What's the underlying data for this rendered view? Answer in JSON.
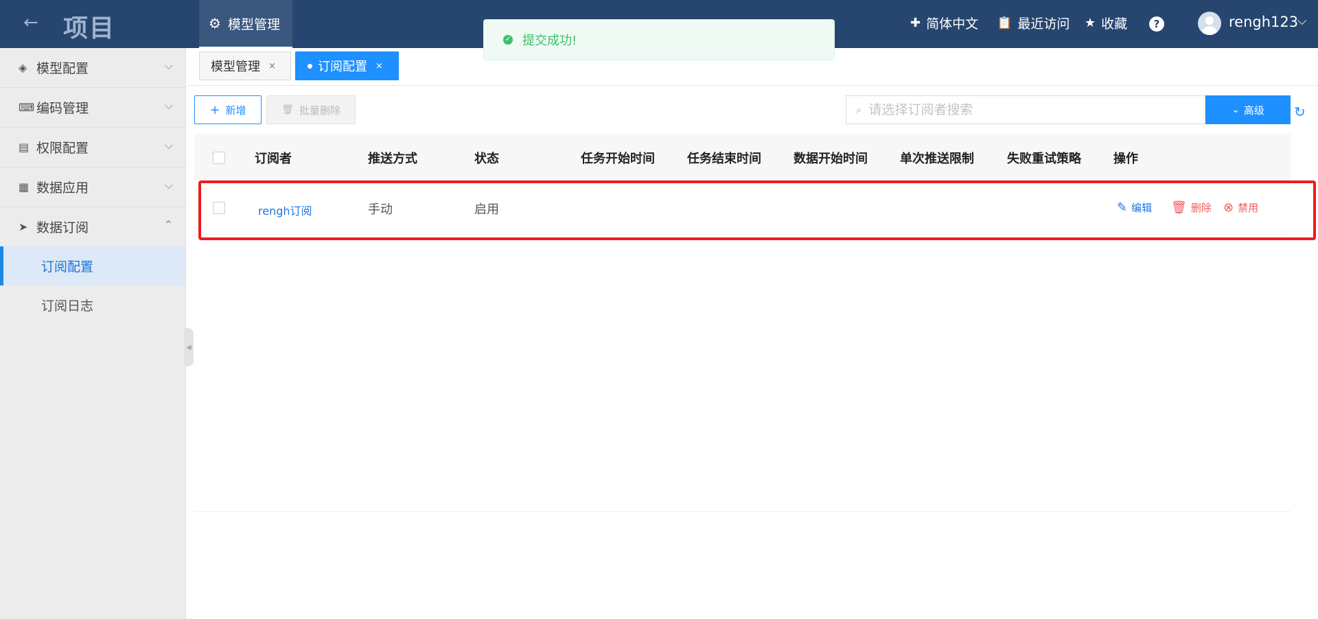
{
  "topbar": {
    "back_icon": "←",
    "project_title": "项目",
    "nav_tab": {
      "icon": "⚙",
      "label": "模型管理"
    },
    "right_items": [
      {
        "name": "language",
        "icon": "✚",
        "label": "简体中文"
      },
      {
        "name": "recent",
        "icon": "📋",
        "label": "最近访问"
      },
      {
        "name": "favorites",
        "icon": "★",
        "label": "收藏"
      }
    ],
    "help": "?",
    "username": "rengh123",
    "user_chevron": "⌵"
  },
  "toast": {
    "icon": "✓",
    "message": "提交成功!"
  },
  "sidebar": {
    "items": [
      {
        "icon": "◈",
        "label": "模型配置",
        "chevron": "⌵"
      },
      {
        "icon": "⌨",
        "label": "编码管理",
        "chevron": "⌵"
      },
      {
        "icon": "▤",
        "label": "权限配置",
        "chevron": "⌵"
      },
      {
        "icon": "▦",
        "label": "数据应用",
        "chevron": "⌵"
      },
      {
        "icon": "➤",
        "label": "数据订阅",
        "chevron": "⌃"
      }
    ],
    "sub_items": [
      {
        "label": "订阅配置",
        "active": true
      },
      {
        "label": "订阅日志",
        "active": false
      }
    ],
    "collapse_icon": "◀"
  },
  "page_tabs": [
    {
      "label": "模型管理",
      "close": "×"
    },
    {
      "label": "订阅配置",
      "close": "×"
    }
  ],
  "toolbar": {
    "add": {
      "icon": "+",
      "label": "新增"
    },
    "batch_delete": {
      "icon": "🗑",
      "label": "批量删除"
    },
    "search": {
      "icon": "⌕",
      "placeholder": "请选择订阅者搜索",
      "value": ""
    },
    "advanced": {
      "icon": "⌄",
      "label": "高级"
    },
    "refresh_icon": "↻"
  },
  "table": {
    "headers": [
      "订阅者",
      "推送方式",
      "状态",
      "任务开始时间",
      "任务结束时间",
      "数据开始时间",
      "单次推送限制",
      "失败重试策略",
      "操作"
    ],
    "rows": [
      {
        "subscriber": "rengh订阅",
        "push_mode": "手动",
        "status": "启用",
        "task_start": "",
        "task_end": "",
        "data_start": "",
        "push_limit": "",
        "retry_policy": "",
        "actions": [
          {
            "icon": "✎",
            "label": "编辑"
          },
          {
            "icon": "🗑",
            "label": "删除"
          },
          {
            "icon": "⊗",
            "label": "禁用"
          }
        ]
      }
    ]
  }
}
